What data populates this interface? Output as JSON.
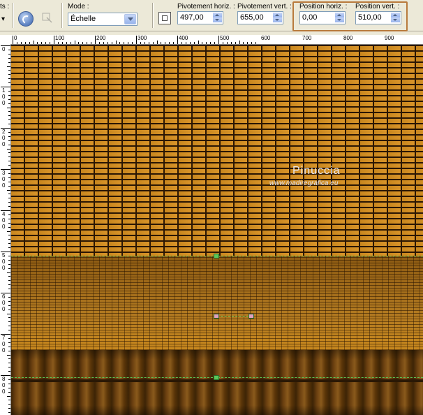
{
  "toolbar": {
    "presets_label": "ts :",
    "mode_label": "Mode :",
    "mode_value": "Échelle",
    "pivot_h_label": "Pivotement horiz. :",
    "pivot_h_value": "497,00",
    "pivot_v_label": "Pivotement vert. :",
    "pivot_v_value": "655,00",
    "pos_h_label": "Position horiz. :",
    "pos_h_value": "0,00",
    "pos_v_label": "Position vert. :",
    "pos_v_value": "510,00",
    "highlight_color": "#b87a3c"
  },
  "ruler_top": [
    "0",
    "100",
    "200",
    "300",
    "400",
    "500",
    "600",
    "700",
    "800",
    "900"
  ],
  "ruler_left": [
    "0",
    "100",
    "200",
    "300",
    "400",
    "500",
    "600",
    "700",
    "800"
  ],
  "watermark": {
    "name": "Pinuccia",
    "url": "www.madiregrafica.eu"
  },
  "colors": {
    "brick": "#d9952a",
    "mortar": "#2a1603",
    "guide": "#5ac85a"
  }
}
